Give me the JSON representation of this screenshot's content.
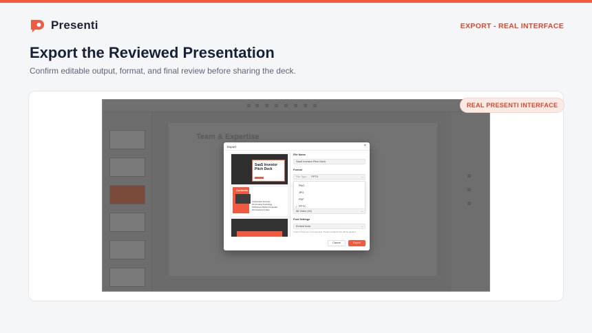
{
  "brand": {
    "name": "Presenti"
  },
  "header": {
    "tag": "EXPORT - REAL INTERFACE"
  },
  "page": {
    "title": "Export the Reviewed Presentation",
    "subtitle": "Confirm editable output, format, and final review before sharing the deck."
  },
  "badge": "REAL PRESENTI INTERFACE",
  "background_app": {
    "slide_title": "Team & Expertise"
  },
  "modal": {
    "title": "Export",
    "close_icon": "close-icon",
    "preview": {
      "slide1_title": "SaaS Investor Pitch Deck",
      "slide2_label": "Contents",
      "slide2_items": [
        "01 Executive Summary",
        "02 Innovative Technology",
        "03 Business Model & Financials",
        "04 Investment & Team"
      ]
    },
    "file_name_label": "File Name",
    "file_name_value": "SaaS Investor Pitch Deck",
    "format_label": "Format",
    "file_type_label": "File Type",
    "file_type_value": "PPTX",
    "format_options": [
      "PNG",
      "JPG",
      "PDF",
      "PPTX"
    ],
    "selected_option": "PPTX",
    "video_option_value": "All Video (16)",
    "font_settings_label": "Font Settings",
    "font_settings_value": "Embed fonts",
    "note": "Custom fonts are not supported. System default fonts will be applied.",
    "cancel_label": "Cancel",
    "export_label": "Export"
  },
  "colors": {
    "accent": "#f05a40",
    "title": "#162036",
    "badge_bg": "#fbe9e4"
  }
}
